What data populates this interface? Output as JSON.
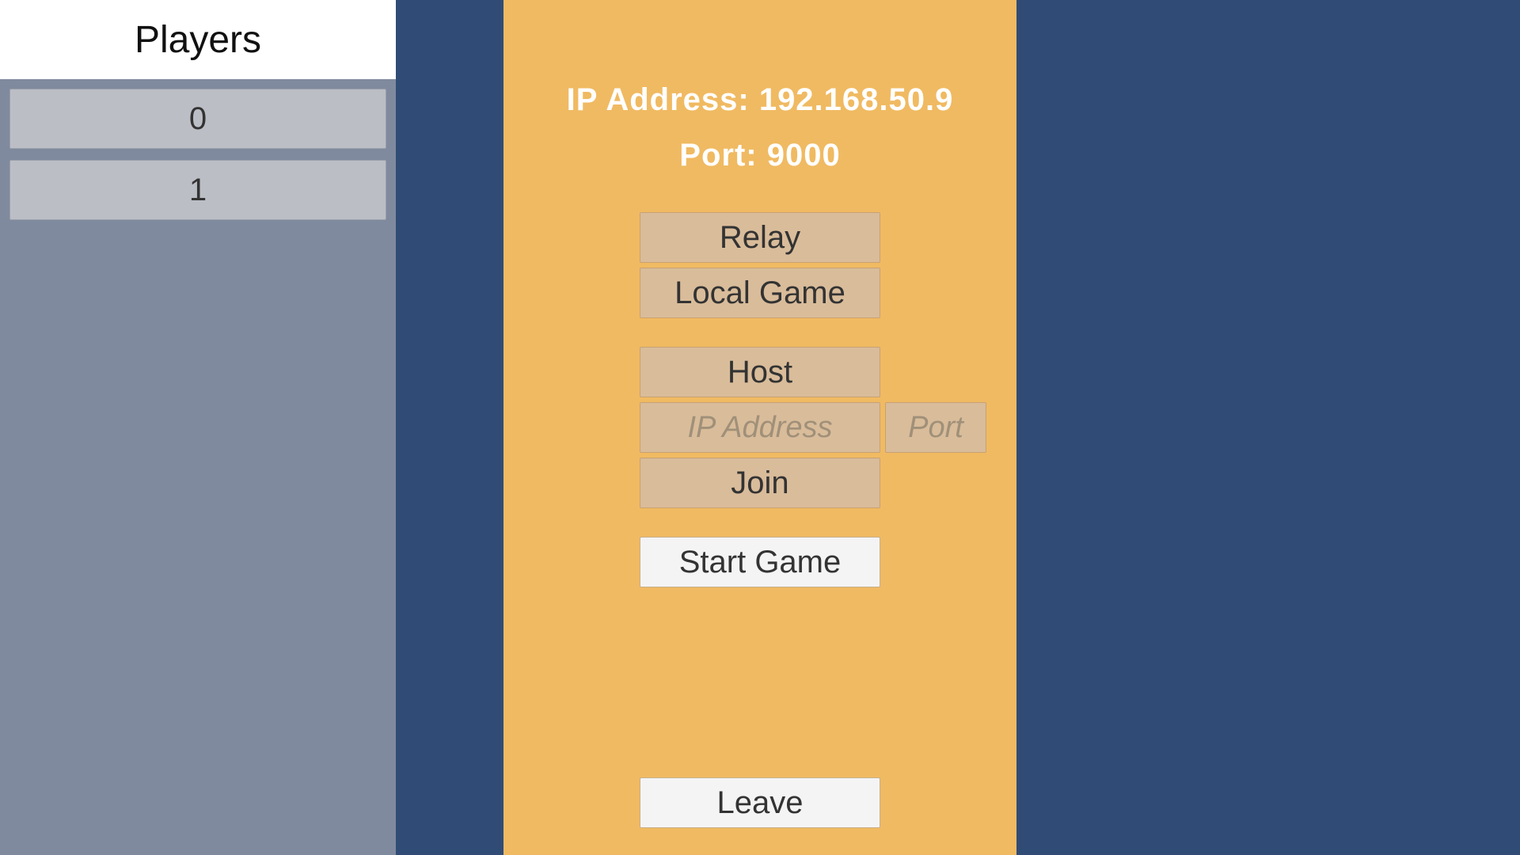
{
  "players": {
    "title": "Players",
    "slots": [
      "0",
      "1"
    ]
  },
  "connection": {
    "ip_address": "IP Address: 192.168.50.9",
    "port": "Port: 9000"
  },
  "buttons": {
    "relay": "Relay",
    "local_game": "Local Game",
    "host": "Host",
    "join": "Join",
    "start_game": "Start Game",
    "leave": "Leave"
  },
  "inputs": {
    "ip_placeholder": "IP Address",
    "port_placeholder": "Port"
  },
  "colors": {
    "background": "#304c76",
    "players_panel": "#808a9e",
    "center_panel": "#f0ba62",
    "button_tan": "#d9bc9a",
    "button_white": "#f4f4f5"
  }
}
